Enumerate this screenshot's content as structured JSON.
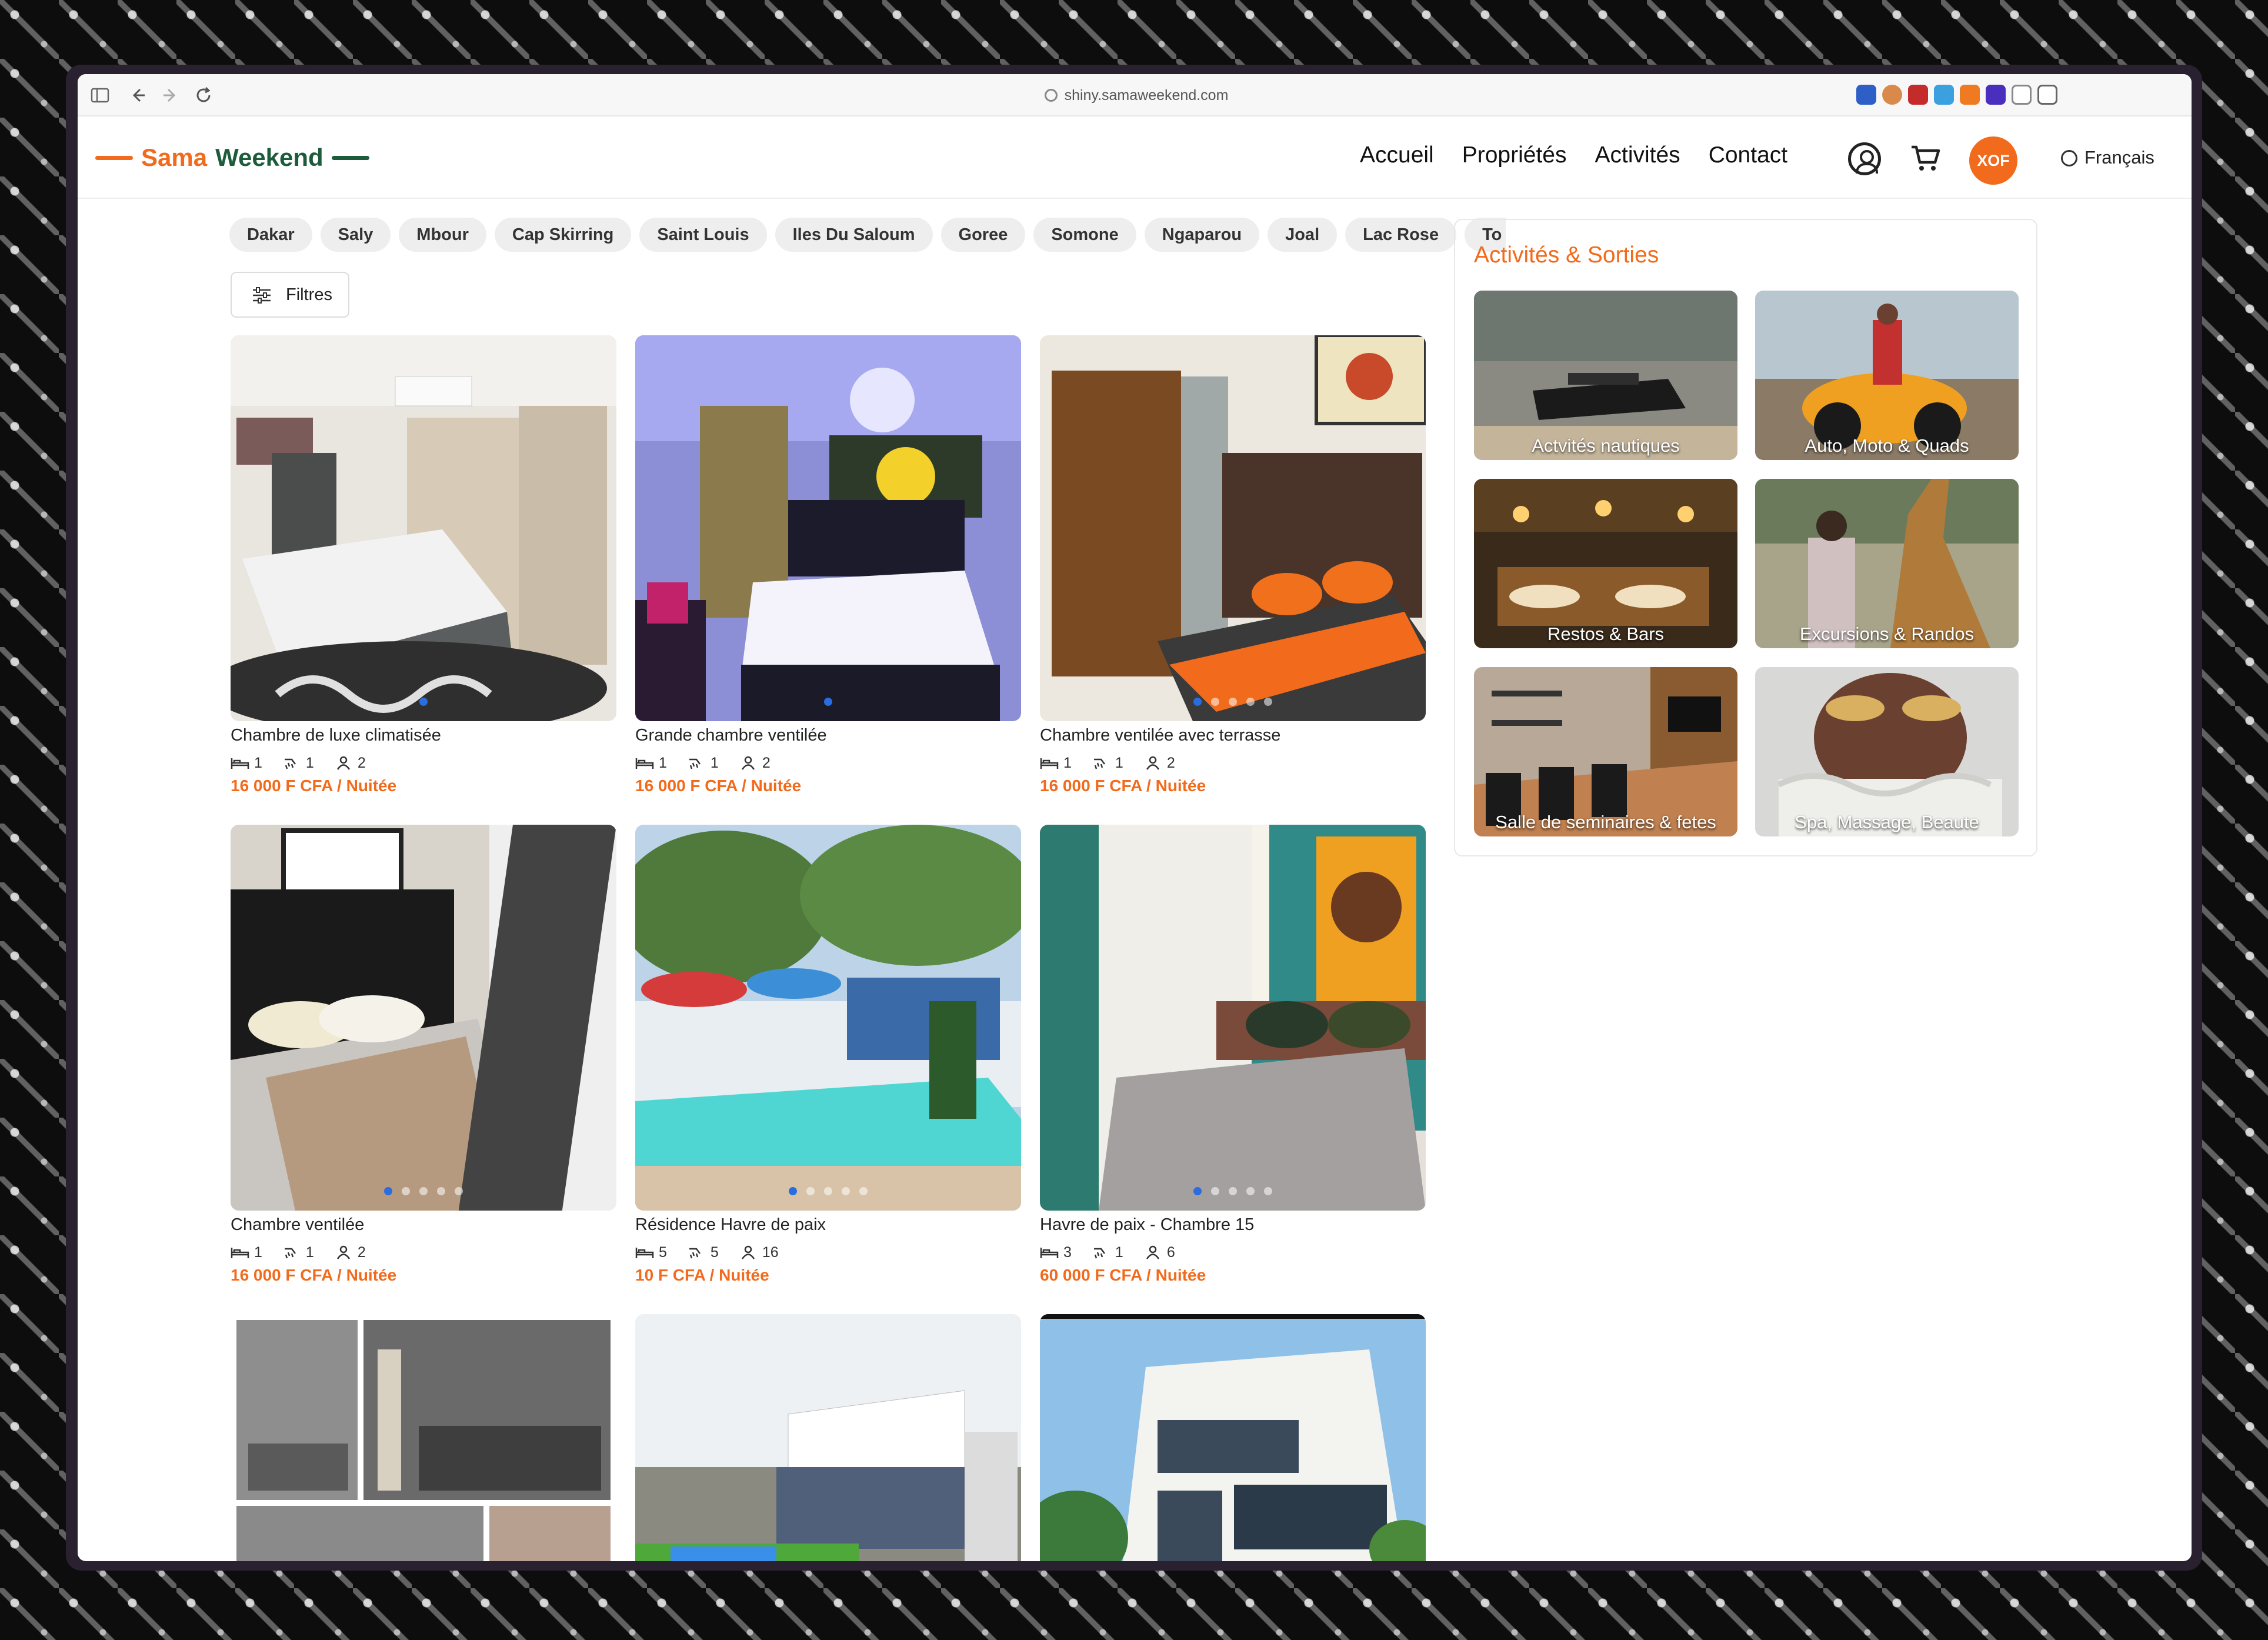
{
  "browser": {
    "url": "shiny.samaweekend.com"
  },
  "site": {
    "logo_word1": "Sama",
    "logo_word2": "Weekend",
    "nav": [
      "Accueil",
      "Propriétés",
      "Activités",
      "Contact"
    ],
    "currency": "XOF",
    "language": "Français",
    "accent_color": "#f26a1b",
    "brand_green": "#1d5c3a"
  },
  "cities": [
    "Dakar",
    "Saly",
    "Mbour",
    "Cap Skirring",
    "Saint Louis",
    "Iles Du Saloum",
    "Goree",
    "Somone",
    "Ngaparou",
    "Joal",
    "Lac Rose",
    "To"
  ],
  "filters_label": "Filtres",
  "listings": [
    {
      "title": "Chambre de luxe climatisée",
      "beds": "1",
      "baths": "1",
      "guests": "2",
      "price": "16 000 F CFA / Nuitée",
      "photo_count": 1,
      "active_photo": 1
    },
    {
      "title": "Grande chambre ventilée",
      "beds": "1",
      "baths": "1",
      "guests": "2",
      "price": "16 000 F CFA / Nuitée",
      "photo_count": 1,
      "active_photo": 1
    },
    {
      "title": "Chambre ventilée avec terrasse",
      "beds": "1",
      "baths": "1",
      "guests": "2",
      "price": "16 000 F CFA / Nuitée",
      "photo_count": 5,
      "active_photo": 1
    },
    {
      "title": "Chambre ventilée",
      "beds": "1",
      "baths": "1",
      "guests": "2",
      "price": "16 000 F CFA / Nuitée",
      "photo_count": 5,
      "active_photo": 1
    },
    {
      "title": "Résidence Havre de paix",
      "beds": "5",
      "baths": "5",
      "guests": "16",
      "price": "10 F CFA / Nuitée",
      "photo_count": 5,
      "active_photo": 1
    },
    {
      "title": "Havre de paix - Chambre 15",
      "beds": "3",
      "baths": "1",
      "guests": "6",
      "price": "60 000 F CFA / Nuitée",
      "photo_count": 5,
      "active_photo": 1
    }
  ],
  "activities": {
    "heading": "Activités & Sorties",
    "tiles": [
      {
        "label": "Actvités nautiques"
      },
      {
        "label": "Auto, Moto & Quads"
      },
      {
        "label": "Restos & Bars"
      },
      {
        "label": "Excursions & Randos"
      },
      {
        "label": "Salle de seminaires & fetes"
      },
      {
        "label": "Spa, Massage, Beaute"
      }
    ]
  }
}
